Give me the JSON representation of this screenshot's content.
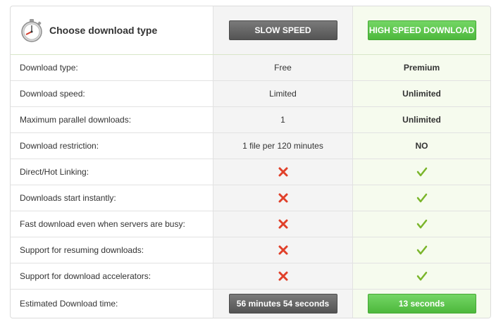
{
  "header": {
    "title": "Choose download type",
    "icon": "stopwatch-icon",
    "slow_button": "SLOW SPEED",
    "fast_button": "HIGH SPEED DOWNLOAD"
  },
  "rows": [
    {
      "label": "Download type:",
      "slow": "Free",
      "fast": "Premium"
    },
    {
      "label": "Download speed:",
      "slow": "Limited",
      "fast": "Unlimited"
    },
    {
      "label": "Maximum parallel downloads:",
      "slow": "1",
      "fast": "Unlimited"
    },
    {
      "label": "Download restriction:",
      "slow": "1 file per 120 minutes",
      "fast": "NO"
    },
    {
      "label": "Direct/Hot Linking:",
      "slow_icon": "cross-icon",
      "fast_icon": "check-icon"
    },
    {
      "label": "Downloads start instantly:",
      "slow_icon": "cross-icon",
      "fast_icon": "check-icon"
    },
    {
      "label": "Fast download even when servers are busy:",
      "slow_icon": "cross-icon",
      "fast_icon": "check-icon"
    },
    {
      "label": "Support for resuming downloads:",
      "slow_icon": "cross-icon",
      "fast_icon": "check-icon"
    },
    {
      "label": "Support for download accelerators:",
      "slow_icon": "cross-icon",
      "fast_icon": "check-icon"
    }
  ],
  "estimate": {
    "label": "Estimated Download time:",
    "slow": "56 minutes 54 seconds",
    "fast": "13 seconds"
  },
  "colors": {
    "slow_button": "#5f5f5f",
    "fast_button": "#5cc64a",
    "cross": "#e0402a",
    "check": "#7ab52a"
  }
}
